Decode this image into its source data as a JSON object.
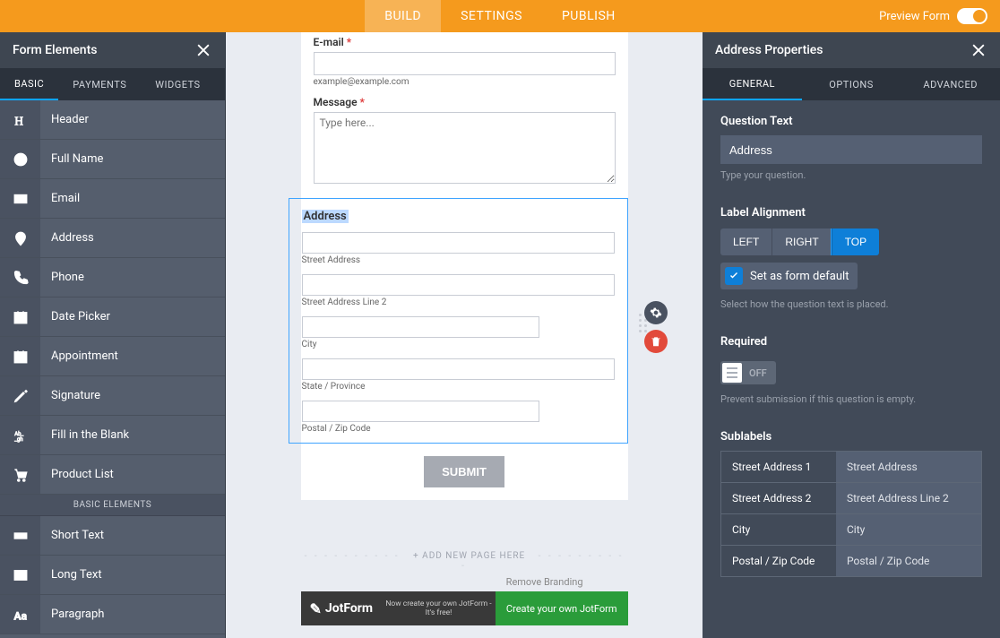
{
  "topbar": {
    "tabs": [
      {
        "label": "BUILD",
        "active": true
      },
      {
        "label": "SETTINGS",
        "active": false
      },
      {
        "label": "PUBLISH",
        "active": false
      }
    ],
    "preview_label": "Preview Form"
  },
  "left": {
    "title": "Form Elements",
    "tabs": [
      {
        "label": "BASIC",
        "active": true
      },
      {
        "label": "PAYMENTS",
        "active": false
      },
      {
        "label": "WIDGETS",
        "active": false
      }
    ],
    "elements_group1": [
      {
        "name": "header",
        "label": "Header",
        "icon": "heading"
      },
      {
        "name": "full-name",
        "label": "Full Name",
        "icon": "user"
      },
      {
        "name": "email",
        "label": "Email",
        "icon": "mail"
      },
      {
        "name": "address",
        "label": "Address",
        "icon": "pin"
      },
      {
        "name": "phone",
        "label": "Phone",
        "icon": "phone"
      },
      {
        "name": "date-picker",
        "label": "Date Picker",
        "icon": "calendar"
      },
      {
        "name": "appointment",
        "label": "Appointment",
        "icon": "calcheck"
      },
      {
        "name": "signature",
        "label": "Signature",
        "icon": "pen"
      },
      {
        "name": "fill-blank",
        "label": "Fill in the Blank",
        "icon": "blank"
      },
      {
        "name": "product-list",
        "label": "Product List",
        "icon": "cart"
      }
    ],
    "section_title": "BASIC ELEMENTS",
    "elements_group2": [
      {
        "name": "short-text",
        "label": "Short Text",
        "icon": "textline"
      },
      {
        "name": "long-text",
        "label": "Long Text",
        "icon": "textbox"
      },
      {
        "name": "paragraph",
        "label": "Paragraph",
        "icon": "para"
      }
    ]
  },
  "form": {
    "email_label": "E-mail",
    "email_sublabel": "example@example.com",
    "message_label": "Message",
    "message_placeholder": "Type here...",
    "address_label": "Address",
    "address_fields": [
      {
        "sublabel": "Street Address",
        "short": false
      },
      {
        "sublabel": "Street Address Line 2",
        "short": false
      },
      {
        "sublabel": "City",
        "short": true
      },
      {
        "sublabel": "State / Province",
        "short": false
      },
      {
        "sublabel": "Postal / Zip Code",
        "short": true
      }
    ],
    "submit_label": "SUBMIT",
    "add_page_label": "+ ADD NEW PAGE HERE",
    "remove_branding_label": "Remove Branding",
    "jot_brand": "JotForm",
    "jot_text": "Now create your own JotForm - It's free!",
    "jot_cta": "Create your own JotForm"
  },
  "right": {
    "title": "Address Properties",
    "tabs": [
      {
        "label": "GENERAL",
        "active": true
      },
      {
        "label": "OPTIONS",
        "active": false
      },
      {
        "label": "ADVANCED",
        "active": false
      }
    ],
    "question_text_label": "Question Text",
    "question_text_value": "Address",
    "question_text_hint": "Type your question.",
    "label_alignment_label": "Label Alignment",
    "alignment_options": [
      {
        "label": "LEFT",
        "sel": false
      },
      {
        "label": "RIGHT",
        "sel": false
      },
      {
        "label": "TOP",
        "sel": true
      }
    ],
    "set_default_label": "Set as form default",
    "alignment_hint": "Select how the question text is placed.",
    "required_label": "Required",
    "required_off": "OFF",
    "required_hint": "Prevent submission if this question is empty.",
    "sublabels_label": "Sublabels",
    "sublabels": [
      {
        "k": "Street Address 1",
        "v": "Street Address"
      },
      {
        "k": "Street Address 2",
        "v": "Street Address Line 2"
      },
      {
        "k": "City",
        "v": "City"
      },
      {
        "k": "Postal / Zip Code",
        "v": "Postal / Zip Code"
      }
    ]
  }
}
